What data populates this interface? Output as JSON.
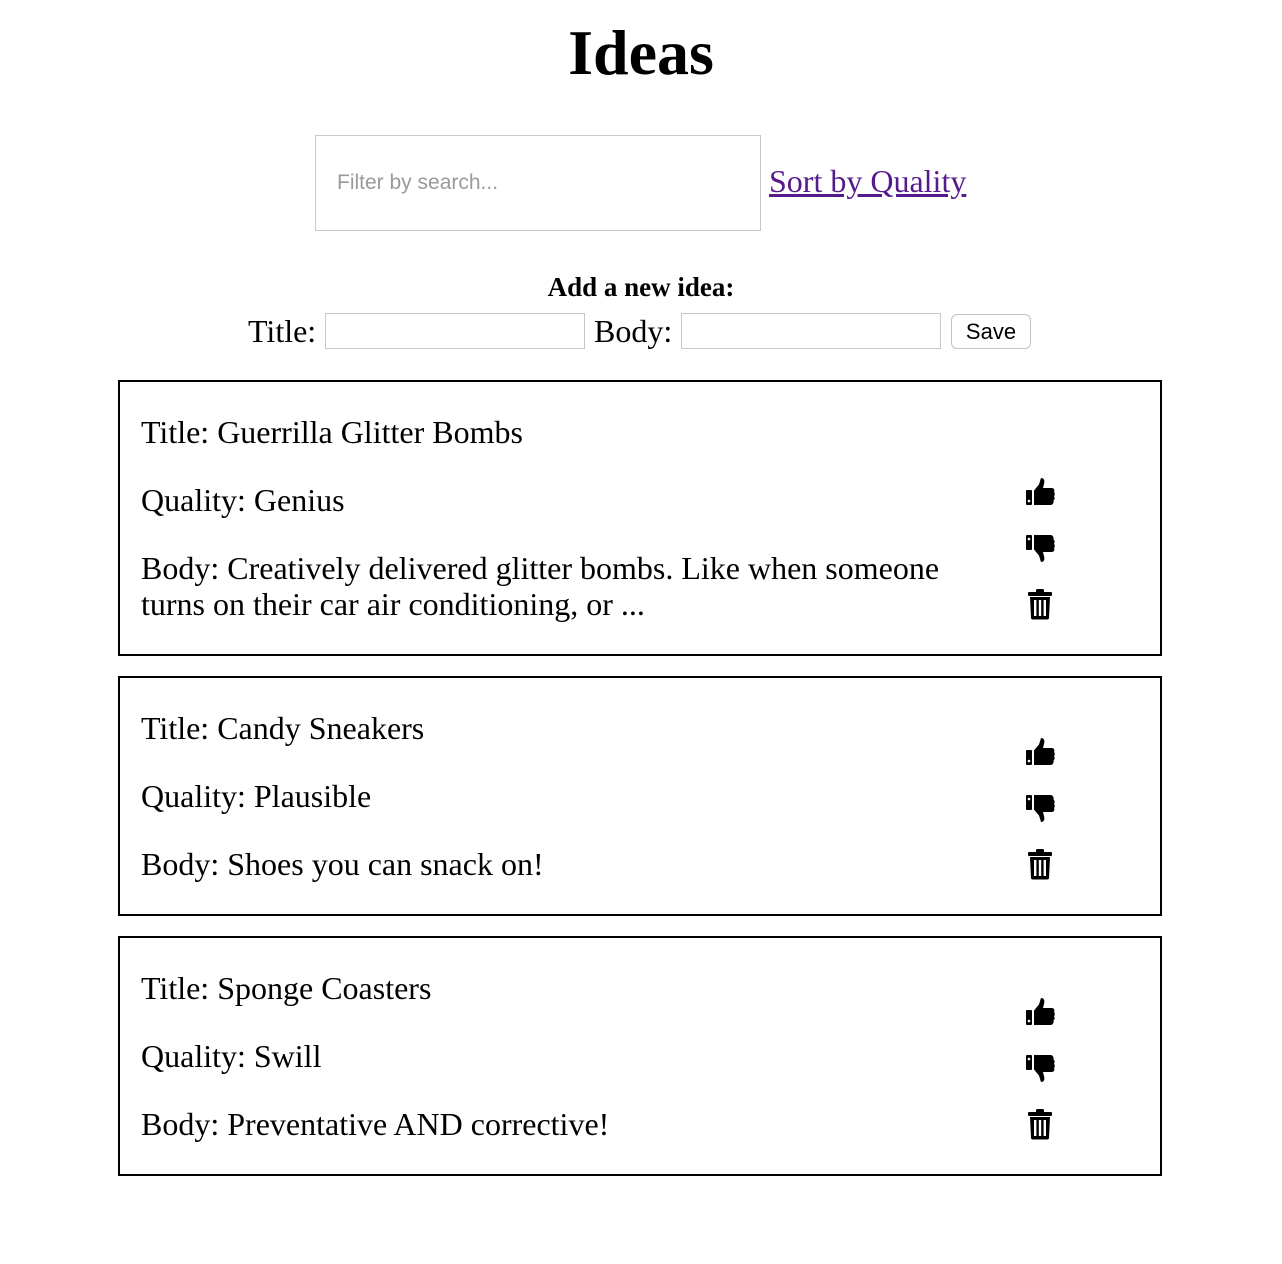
{
  "page": {
    "title": "Ideas"
  },
  "search": {
    "placeholder": "Filter by search...",
    "value": ""
  },
  "sort_link_label": "Sort by Quality",
  "form": {
    "heading": "Add a new idea:",
    "title_label": "Title:",
    "body_label": "Body:",
    "title_value": "",
    "body_value": "",
    "save_label": "Save"
  },
  "ideas": [
    {
      "title": "Title: Guerrilla Glitter Bombs",
      "quality": "Quality: Genius",
      "body": "Body: Creatively delivered glitter bombs. Like when someone turns on their car air conditioning, or ..."
    },
    {
      "title": "Title: Candy Sneakers",
      "quality": "Quality: Plausible",
      "body": "Body: Shoes you can snack on!"
    },
    {
      "title": "Title: Sponge Coasters",
      "quality": "Quality: Swill",
      "body": "Body: Preventative AND corrective!"
    }
  ],
  "icons": {
    "upvote": "thumbs-up-icon",
    "downvote": "thumbs-down-icon",
    "delete": "trash-icon"
  }
}
